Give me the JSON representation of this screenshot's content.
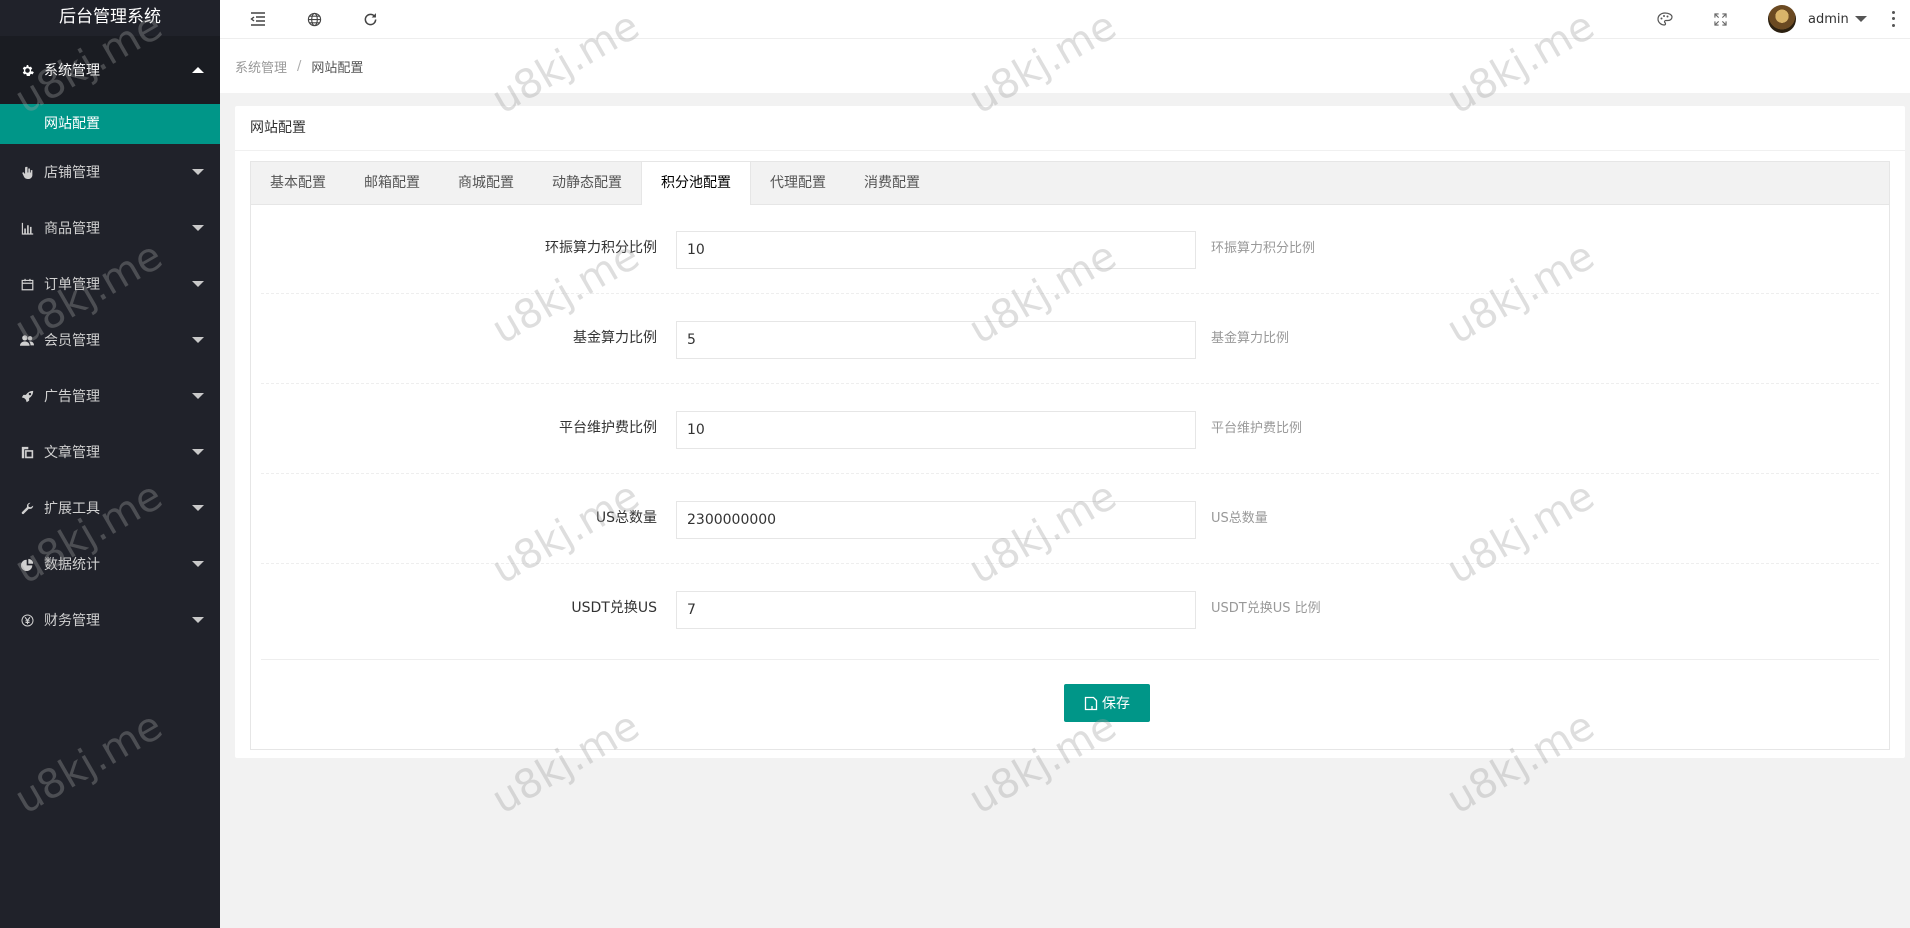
{
  "app": {
    "title": "后台管理系统"
  },
  "sidebar": {
    "items": [
      {
        "label": "系统管理",
        "icon": "gear-icon",
        "open": true,
        "children": [
          {
            "label": "网站配置",
            "active": true
          }
        ]
      },
      {
        "label": "店铺管理",
        "icon": "hand-icon"
      },
      {
        "label": "商品管理",
        "icon": "bar-chart-icon"
      },
      {
        "label": "订单管理",
        "icon": "calendar-icon"
      },
      {
        "label": "会员管理",
        "icon": "users-icon"
      },
      {
        "label": "广告管理",
        "icon": "rocket-icon"
      },
      {
        "label": "文章管理",
        "icon": "copy-icon"
      },
      {
        "label": "扩展工具",
        "icon": "wrench-icon"
      },
      {
        "label": "数据统计",
        "icon": "pie-chart-icon"
      },
      {
        "label": "财务管理",
        "icon": "yen-icon"
      }
    ]
  },
  "header": {
    "icons": [
      "menu-fold-icon",
      "globe-icon",
      "refresh-icon",
      "theme-icon",
      "fullscreen-icon",
      "more-icon"
    ],
    "user": {
      "name": "admin"
    }
  },
  "breadcrumb": {
    "items": [
      "系统管理",
      "网站配置"
    ]
  },
  "card": {
    "title": "网站配置"
  },
  "tabs": {
    "items": [
      "基本配置",
      "邮箱配置",
      "商城配置",
      "动静态配置",
      "积分池配置",
      "代理配置",
      "消费配置"
    ],
    "active_index": 4
  },
  "form": {
    "fields": [
      {
        "label": "环振算力积分比例",
        "value": "10",
        "aux": "环振算力积分比例"
      },
      {
        "label": "基金算力比例",
        "value": "5",
        "aux": "基金算力比例"
      },
      {
        "label": "平台维护费比例",
        "value": "10",
        "aux": "平台维护费比例"
      },
      {
        "label": "US总数量",
        "value": "2300000000",
        "aux": "US总数量"
      },
      {
        "label": "USDT兑换US",
        "value": "7",
        "aux": "USDT兑换US 比例"
      }
    ],
    "save_label": "保存"
  },
  "watermark": {
    "text": "u8kj.me"
  },
  "colors": {
    "sidebar_bg": "#20222a",
    "accent": "#009688"
  }
}
